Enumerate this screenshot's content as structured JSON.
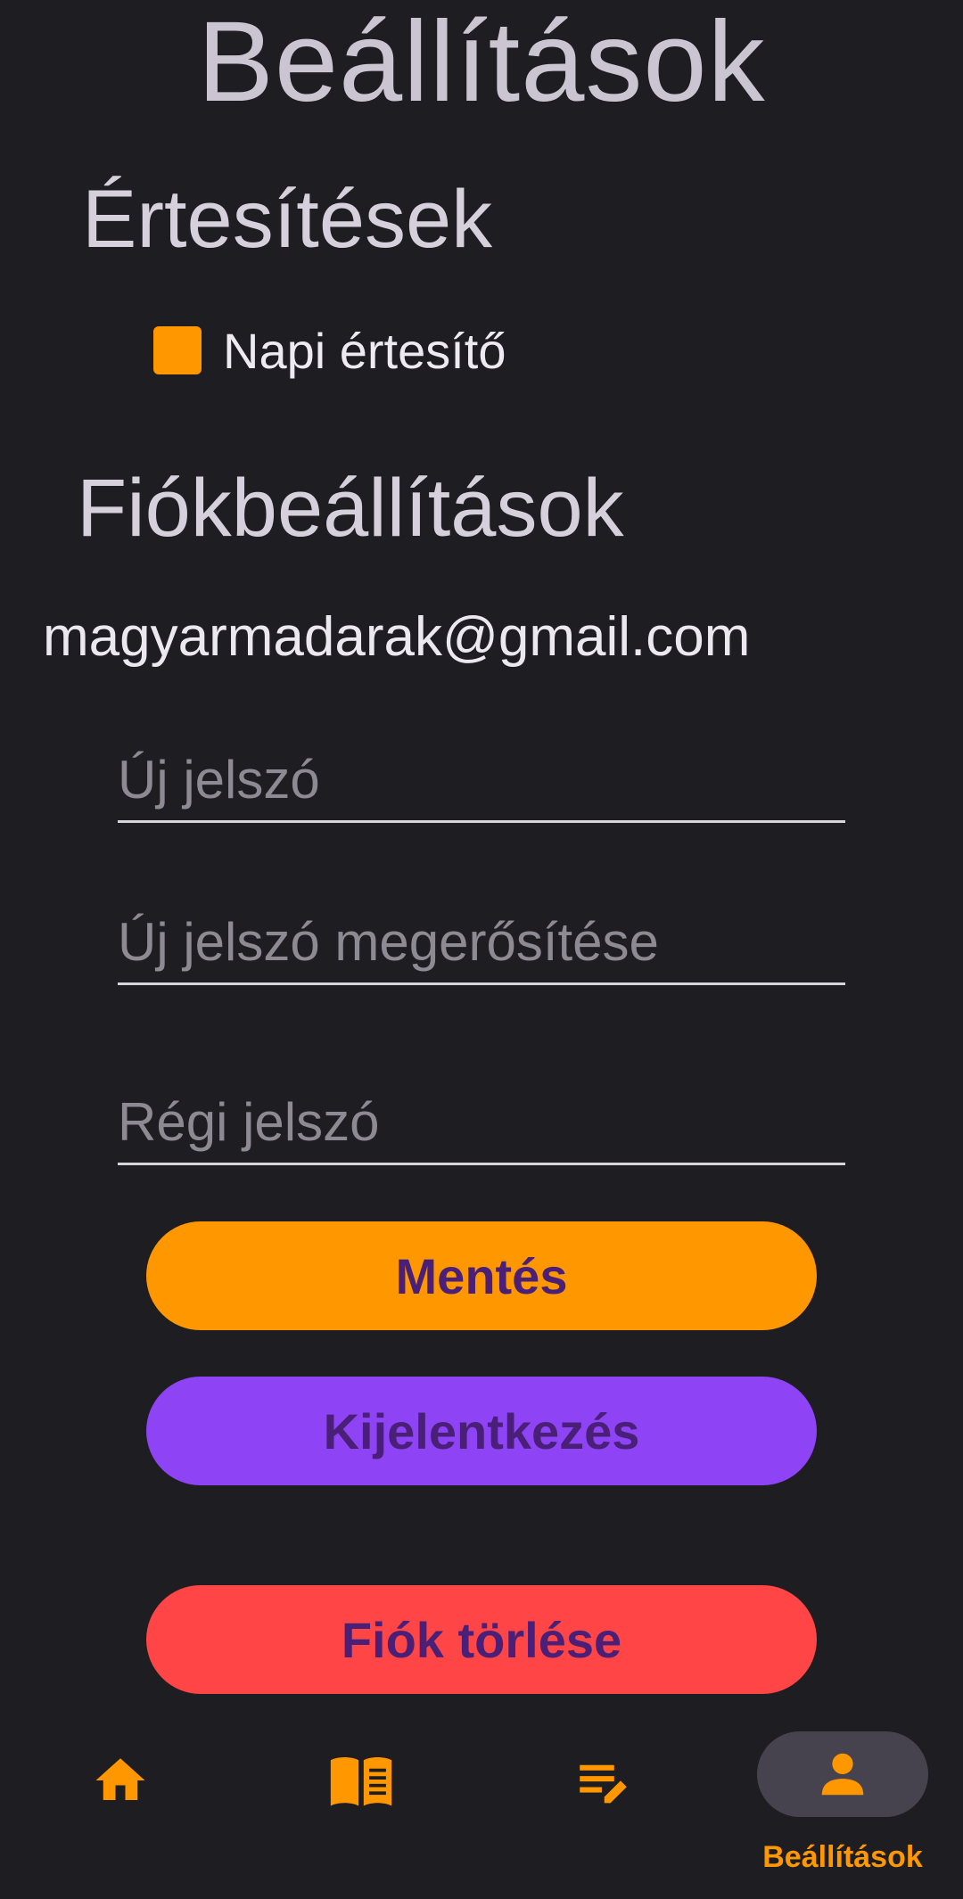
{
  "page": {
    "title": "Beállítások"
  },
  "notifications": {
    "section_title": "Értesítések",
    "daily_label": "Napi értesítő",
    "daily_checked": true
  },
  "account": {
    "section_title": "Fiókbeállítások",
    "email": "magyarmadarak@gmail.com",
    "new_password_placeholder": "Új jelszó",
    "confirm_password_placeholder": "Új jelszó megerősítése",
    "old_password_placeholder": "Régi jelszó",
    "save_label": "Mentés",
    "logout_label": "Kijelentkezés",
    "delete_label": "Fiók törlése"
  },
  "bottom_nav": {
    "items": [
      {
        "icon": "home-icon"
      },
      {
        "icon": "book-icon"
      },
      {
        "icon": "edit-list-icon"
      },
      {
        "icon": "person-icon",
        "label": "Beállítások",
        "active": true
      }
    ]
  },
  "colors": {
    "accent": "#ff9800",
    "logout": "#8e44f5",
    "delete": "#ff4545",
    "button_text": "#4a1f78",
    "background": "#1e1d21"
  }
}
